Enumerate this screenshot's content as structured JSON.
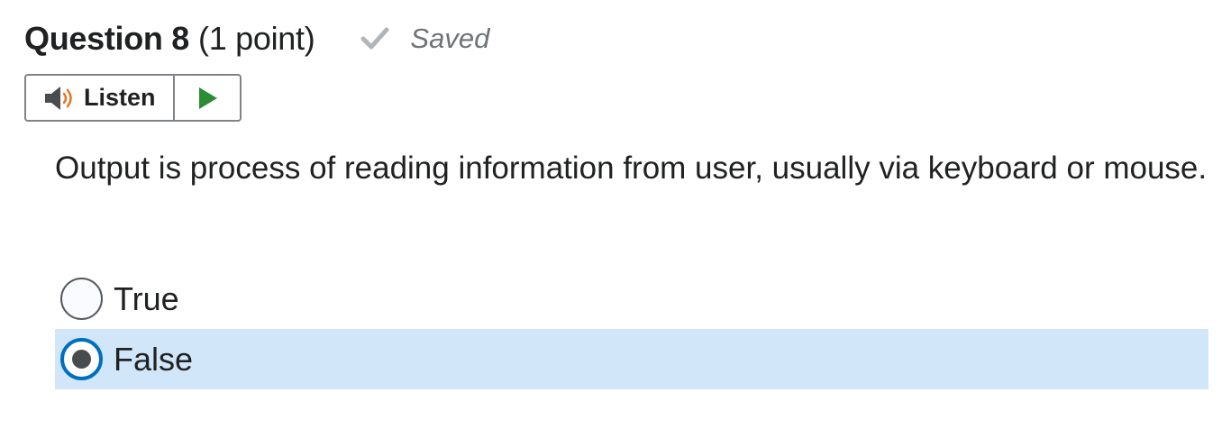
{
  "question": {
    "title": "Question 8",
    "points": "(1 point)",
    "status": "Saved",
    "status_icon": "check-icon",
    "text": "Output is process of reading information from user, usually via keyboard or mouse."
  },
  "listen": {
    "label": "Listen",
    "speaker_icon": "speaker-icon",
    "play_icon": "play-icon"
  },
  "options": [
    {
      "label": "True",
      "selected": false
    },
    {
      "label": "False",
      "selected": true
    }
  ],
  "colors": {
    "selected_row": "#d1e6f9",
    "radio_checked_border": "#006fbf",
    "play_green": "#2a8c34",
    "speaker_orange": "#e87722",
    "check_gray": "#b1b5b8"
  }
}
